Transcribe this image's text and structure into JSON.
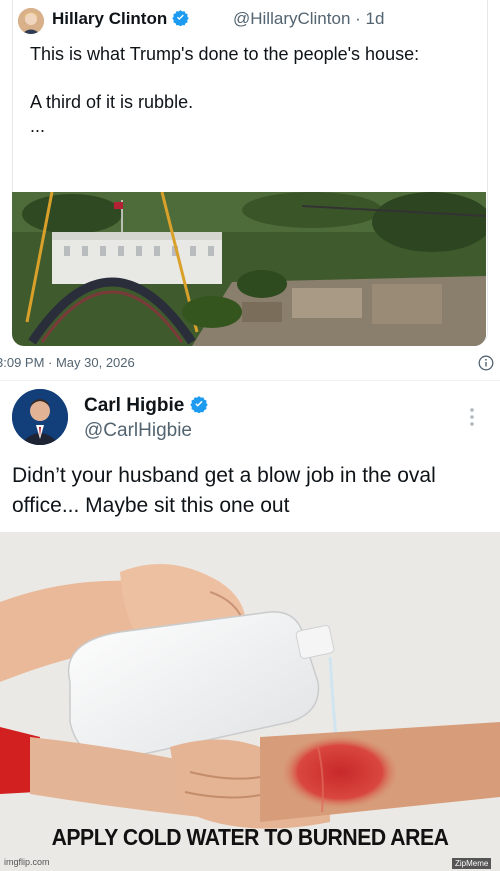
{
  "tweet1": {
    "display_name": "Hillary Clinton",
    "handle": "@HillaryClinton",
    "age": "· 1d",
    "text": "This is what Trump's done to the people's house:\n\nA third of it is rubble.\n...",
    "timestamp": "3:09 PM · May 30, 2026",
    "avatar_icon": "avatar-photo",
    "verified_icon": "verified-badge-icon"
  },
  "tweet2": {
    "display_name": "Carl Higbie",
    "handle": "@CarlHigbie",
    "text": "Didn’t your husband get a blow job in the oval office... Maybe sit this one out",
    "avatar_icon": "avatar-photo",
    "more_icon": "more-options-icon"
  },
  "meme": {
    "caption": "APPLY COLD WATER TO BURNED AREA",
    "watermark_left": "imgflip.com",
    "watermark_right": "ZipMeme"
  },
  "colors": {
    "verified_blue": "#1d9bf0",
    "text_primary": "#0f1419",
    "text_secondary": "#536471"
  }
}
